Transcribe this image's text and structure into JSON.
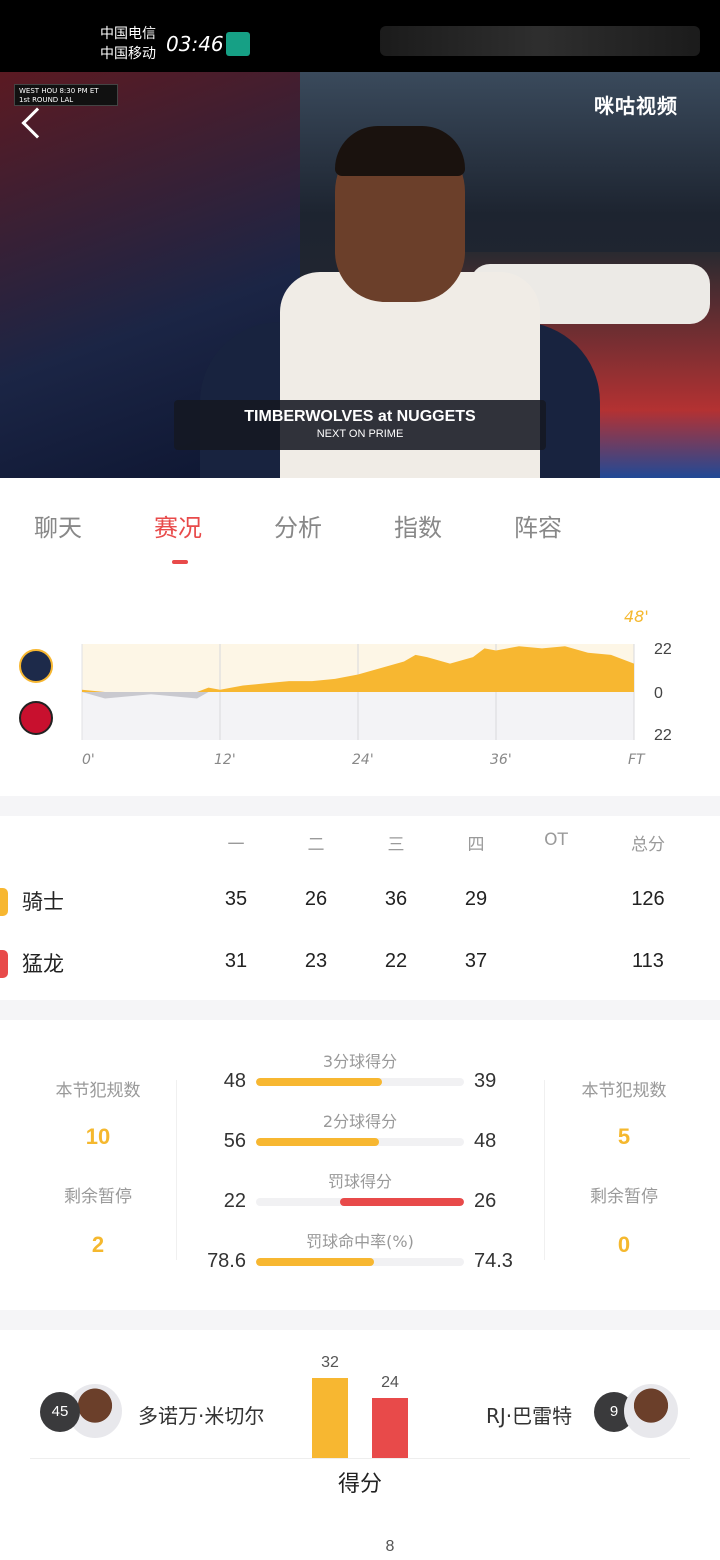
{
  "status_bar": {
    "carrier1": "中国电信",
    "carrier2": "中国移动",
    "time": "03:46"
  },
  "video": {
    "score_bug": {
      "conf": "WEST",
      "round": "1st ROUND",
      "team1": "HOU",
      "team2": "LAL",
      "time": "8:30 PM ET"
    },
    "brand": "咪咕视频",
    "banner_title": "TIMBERWOLVES at NUGGETS",
    "banner_sub": "NEXT ON PRIME"
  },
  "tabs": [
    {
      "label": "聊天"
    },
    {
      "label": "赛况"
    },
    {
      "label": "分析"
    },
    {
      "label": "指数"
    },
    {
      "label": "阵容"
    }
  ],
  "active_tab": "赛况",
  "colors": {
    "cavs": "#f7b731",
    "raptors": "#e84a4a",
    "accent": "#e84a4a",
    "track": "#f1f1f3"
  },
  "chart_data": {
    "type": "area",
    "x_ticks": [
      "0'",
      "12'",
      "24'",
      "36'",
      "FT"
    ],
    "y_ticks_right": [
      "22",
      "0",
      "22"
    ],
    "current_time_label": "48'",
    "ylim": [
      -22,
      22
    ],
    "x": [
      0,
      2,
      4,
      6,
      8,
      10,
      11,
      12,
      14,
      16,
      18,
      20,
      22,
      24,
      26,
      28,
      29,
      30,
      32,
      34,
      35,
      36,
      38,
      40,
      42,
      44,
      46,
      48
    ],
    "values": [
      1,
      -3,
      -2,
      -1,
      -2,
      -3,
      2,
      1,
      3,
      4,
      5,
      5,
      6,
      8,
      11,
      14,
      17,
      16,
      13,
      16,
      20,
      19,
      21,
      20,
      21,
      18,
      17,
      13
    ]
  },
  "quarters": {
    "headers": [
      "一",
      "二",
      "三",
      "四",
      "OT",
      "总分"
    ],
    "teams": [
      {
        "name": "骑士",
        "scores": [
          "35",
          "26",
          "36",
          "29",
          "",
          "126"
        ]
      },
      {
        "name": "猛龙",
        "scores": [
          "31",
          "23",
          "22",
          "37",
          "",
          "113"
        ]
      }
    ]
  },
  "side_stats": {
    "left": {
      "fouls_label": "本节犯规数",
      "fouls": "10",
      "timeouts_label": "剩余暂停",
      "timeouts": "2"
    },
    "right": {
      "fouls_label": "本节犯规数",
      "fouls": "5",
      "timeouts_label": "剩余暂停",
      "timeouts": "0"
    }
  },
  "compare_stats": [
    {
      "label": "3分球得分",
      "left": "48",
      "right": "39",
      "left_num": 48,
      "right_num": 39,
      "leader": "left"
    },
    {
      "label": "2分球得分",
      "left": "56",
      "right": "48",
      "left_num": 56,
      "right_num": 48,
      "leader": "left"
    },
    {
      "label": "罚球得分",
      "left": "22",
      "right": "26",
      "left_num": 22,
      "right_num": 26,
      "leader": "right"
    },
    {
      "label": "罚球命中率(%)",
      "left": "78.6",
      "right": "74.3",
      "left_num": 78.6,
      "right_num": 74.3,
      "leader": "left"
    }
  ],
  "leaders": {
    "category": "得分",
    "left": {
      "number": "45",
      "name": "多诺万·米切尔",
      "value": "32",
      "value_num": 32
    },
    "right": {
      "number": "9",
      "name": "RJ·巴雷特",
      "value": "24",
      "value_num": 24
    },
    "page": "8"
  }
}
